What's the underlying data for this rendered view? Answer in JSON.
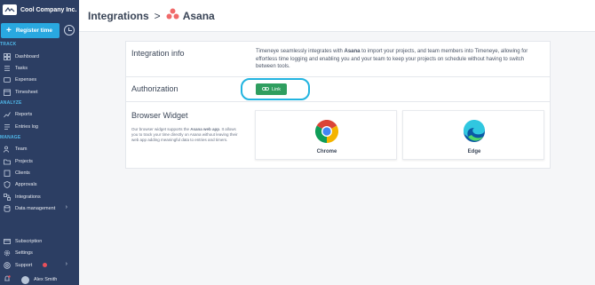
{
  "app": {
    "company_name": "Cool Company Inc."
  },
  "sidebar": {
    "register_label": "Register time",
    "sections": {
      "track": "TRACK",
      "analyze": "ANALYZE",
      "manage": "MANAGE"
    },
    "items": {
      "dashboard": "Dashboard",
      "tasks": "Tasks",
      "expenses": "Expenses",
      "timesheet": "Timesheet",
      "reports": "Reports",
      "entries_log": "Entries log",
      "team": "Team",
      "projects": "Projects",
      "clients": "Clients",
      "approvals": "Approvals",
      "integrations": "Integrations",
      "data_management": "Data management",
      "subscription": "Subscription",
      "settings": "Settings",
      "support": "Support"
    },
    "user_name": "Alex Smith"
  },
  "header": {
    "title": "Integrations",
    "separator": ">",
    "integration_name": "Asana"
  },
  "content": {
    "integration_info_label": "Integration info",
    "info_parts": {
      "p1": "Timeneye seamlessly integrates with ",
      "bold": "Asana",
      "p2": " to import your projects, and team members into Timeneye, allowing for effortless time logging and enabling you and your team to keep your projects on schedule without having to switch between tools."
    },
    "authorization_label": "Authorization",
    "link_button_label": "Link",
    "browser_widget_label": "Browser Widget",
    "widget_desc_parts": {
      "p1": "Our browser widget supports the ",
      "bold": "Asana web app",
      "p2": ". It allows you to track your time directly on Asana without leaving their web app adding meaningful data to entries and timers."
    },
    "browsers": {
      "chrome": "Chrome",
      "edge": "Edge"
    }
  },
  "colors": {
    "sidebar_bg": "#2c3e63",
    "accent_blue": "#29a8e0",
    "link_green": "#2f9e5f",
    "highlight_cyan": "#22b4e0",
    "asana_coral": "#f06a6a"
  }
}
